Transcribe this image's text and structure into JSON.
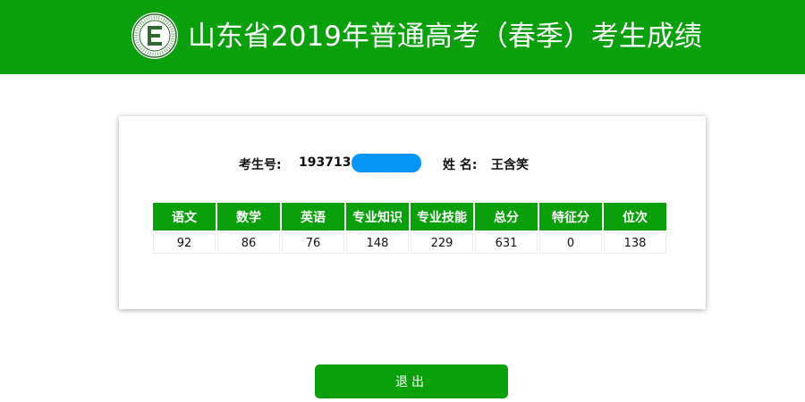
{
  "header": {
    "title": "山东省2019年普通高考（春季）考生成绩",
    "logo": "school-emblem-icon",
    "background_color": "#0aa00c"
  },
  "candidate": {
    "id_label": "考生号:",
    "id_value": "193713",
    "name_label": "姓 名:",
    "name_value": "王含笑",
    "redaction_color": "#0796f6"
  },
  "scores": {
    "headers": [
      "语文",
      "数学",
      "英语",
      "专业知识",
      "专业技能",
      "总分",
      "特征分",
      "位次"
    ],
    "values": [
      "92",
      "86",
      "76",
      "148",
      "229",
      "631",
      "0",
      "138"
    ]
  },
  "actions": {
    "logout_label": "退出"
  }
}
